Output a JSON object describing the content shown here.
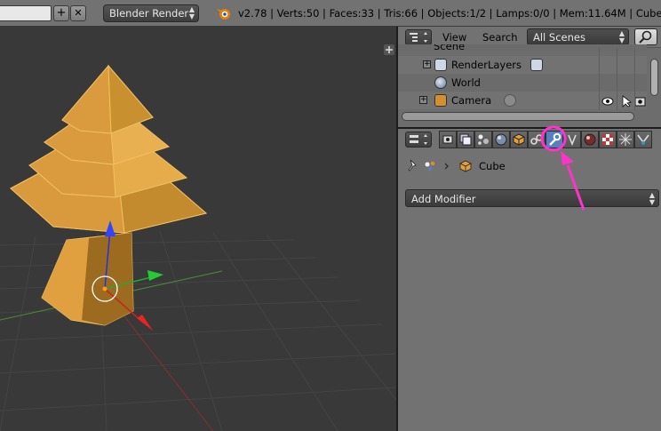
{
  "header": {
    "render_engine": "Blender Render",
    "stats": "v2.78 | Verts:50 | Faces:33 | Tris:66 | Objects:1/2 | Lamps:0/0 | Mem:11.64M | Cube",
    "add_symbol": "+",
    "close_symbol": "✕"
  },
  "outliner": {
    "menu_view": "View",
    "menu_search": "Search",
    "display_mode": "All Scenes",
    "items": [
      {
        "label": "Scene"
      },
      {
        "label": "RenderLayers"
      },
      {
        "label": "World"
      },
      {
        "label": "Camera"
      }
    ]
  },
  "properties": {
    "context_object": "Cube",
    "add_modifier_label": "Add Modifier",
    "tabs": [
      {
        "icon": "render-icon"
      },
      {
        "icon": "render-layers-icon"
      },
      {
        "icon": "scene-icon"
      },
      {
        "icon": "world-icon"
      },
      {
        "icon": "object-icon"
      },
      {
        "icon": "constraints-icon"
      },
      {
        "icon": "modifier-wrench-icon",
        "active": true
      },
      {
        "icon": "data-icon"
      },
      {
        "icon": "material-icon"
      },
      {
        "icon": "texture-icon"
      },
      {
        "icon": "particles-icon"
      },
      {
        "icon": "physics-icon"
      }
    ]
  },
  "colors": {
    "annotation": "#ff33cc",
    "mesh": "#e0a040",
    "active_tab": "#5680c2"
  }
}
